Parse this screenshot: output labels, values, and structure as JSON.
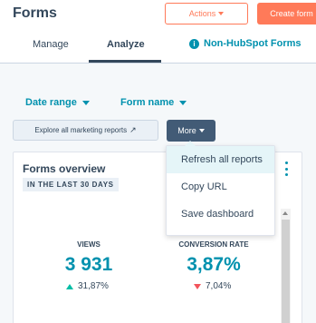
{
  "header": {
    "title": "Forms",
    "actions_label": "Actions",
    "create_label": "Create form"
  },
  "tabs": [
    {
      "label": "Manage"
    },
    {
      "label": "Analyze",
      "active": true
    }
  ],
  "non_hubspot_link": "Non-HubSpot Forms",
  "filters": {
    "date_range_label": "Date range",
    "form_name_label": "Form name"
  },
  "toolbar": {
    "explore_label": "Explore all marketing reports",
    "more_label": "More"
  },
  "more_menu": {
    "items": [
      {
        "label": "Refresh all reports"
      },
      {
        "label": "Copy URL"
      },
      {
        "label": "Save dashboard"
      }
    ]
  },
  "overview": {
    "title": "Forms overview",
    "date_tag": "IN THE LAST 30 DAYS",
    "metrics": [
      {
        "label": "VIEWS",
        "value": "3 931",
        "change": "31,87%",
        "direction": "up"
      },
      {
        "label": "CONVERSION RATE",
        "value": "3,87%",
        "change": "7,04%",
        "direction": "down"
      }
    ]
  },
  "colors": {
    "accent": "#ff7a59",
    "link": "#0091ae",
    "up": "#00bda5",
    "down": "#f2545b",
    "dark_button": "#425b76"
  }
}
